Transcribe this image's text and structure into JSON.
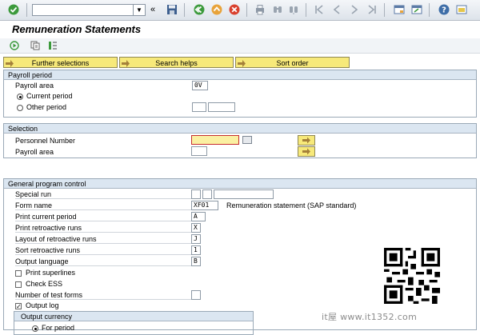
{
  "toolbar": {
    "command_field_value": "",
    "icons": [
      "check-icon",
      "back-icon",
      "save-icon",
      "back-nav-icon",
      "exit-icon",
      "cancel-icon",
      "print-icon",
      "find-icon",
      "find-next-icon",
      "first-page-icon",
      "previous-page-icon",
      "next-page-icon",
      "last-page-icon",
      "new-session-icon",
      "shortcut-icon",
      "help-icon",
      "customize-layout-icon"
    ]
  },
  "title": "Remuneration Statements",
  "app_toolbar": {
    "icons": [
      "execute-icon",
      "get-variant-icon",
      "selection-options-icon"
    ]
  },
  "buttons": {
    "further_selections": "Further selections",
    "search_helps": "Search helps",
    "sort_order": "Sort order"
  },
  "payroll_period": {
    "heading": "Payroll period",
    "payroll_area_label": "Payroll area",
    "payroll_area_value": "0V",
    "current_period_label": "Current period",
    "other_period_label": "Other period",
    "selected": "current"
  },
  "selection": {
    "heading": "Selection",
    "personnel_number_label": "Personnel Number",
    "personnel_number_value": "",
    "payroll_area_label": "Payroll area",
    "payroll_area_value": ""
  },
  "general": {
    "heading": "General program control",
    "rows": [
      {
        "label": "Special run",
        "value": ""
      },
      {
        "label": "Form name",
        "value": "XF01",
        "description": "Remuneration statement (SAP standard)"
      },
      {
        "label": "Print current period",
        "value": "A"
      },
      {
        "label": "Print retroactive runs",
        "value": "X"
      },
      {
        "label": "Layout of retroactive runs",
        "value": "J"
      },
      {
        "label": "Sort retroactive runs",
        "value": "1"
      },
      {
        "label": "Output language",
        "value": "B"
      }
    ],
    "print_superlines_label": "Print superlines",
    "print_superlines_checked": false,
    "check_ess_label": "Check ESS",
    "check_ess_checked": false,
    "number_test_forms_label": "Number of test forms",
    "number_test_forms_value": "",
    "output_log_label": "Output log",
    "output_log_checked": true,
    "output_currency_heading": "Output currency",
    "for_period_label": "For period"
  },
  "watermark": "it屋 www.it1352.com"
}
